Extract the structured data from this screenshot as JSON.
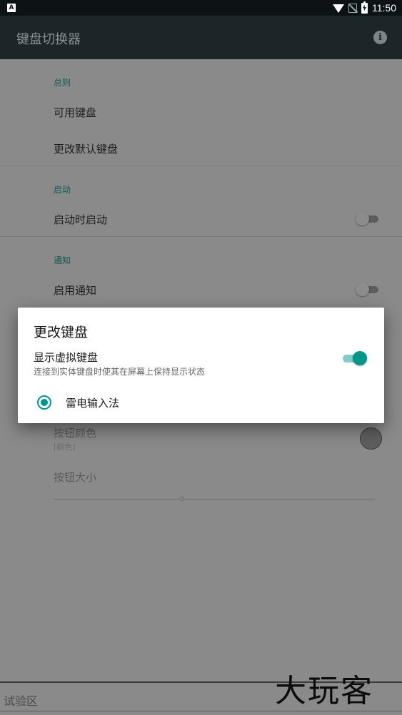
{
  "status_bar": {
    "notification_icon": "A",
    "time": "11:50",
    "icons": [
      "wifi-icon",
      "no-sim-icon",
      "battery-charging-icon"
    ]
  },
  "app_bar": {
    "title": "键盘切换器",
    "info_icon": "info-icon"
  },
  "sections": {
    "general": {
      "header": "总则",
      "items": [
        "可用键盘",
        "更改默认键盘"
      ]
    },
    "startup": {
      "header": "启动",
      "item": "启动时启动",
      "switch_on": false
    },
    "notification": {
      "header": "通知",
      "item": "启用通知",
      "switch_on": false
    },
    "appearance": {
      "button_color_label": "按钮颜色",
      "button_color_sub": "[颜色]",
      "button_size_label": "按钮大小",
      "button_size_value": 0.4
    }
  },
  "test_area": {
    "label": "试验区"
  },
  "watermark": "大玩客",
  "dialog": {
    "title": "更改键盘",
    "option_title": "显示虚拟键盘",
    "option_subtitle": "连接到实体键盘时使其在屏幕上保持显示状态",
    "option_switch_on": true,
    "keyboards": [
      {
        "label": "雷电输入法",
        "selected": true
      }
    ]
  },
  "colors": {
    "accent": "#009688",
    "accent_light": "#80cbc4",
    "app_bar": "#1c2628",
    "status_bar": "#0d1214",
    "scrim_background": "#8a8a8a"
  }
}
